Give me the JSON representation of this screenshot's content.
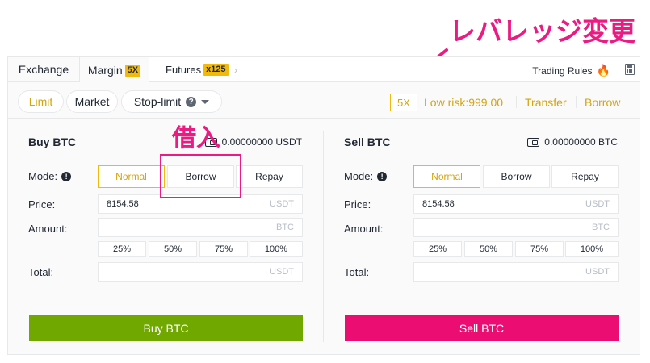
{
  "annotations": {
    "leverage_note": "レバレッジ変更",
    "borrow_note": "借入",
    "accent_color": "#ec1b83"
  },
  "tabs": {
    "exchange": "Exchange",
    "margin": "Margin",
    "margin_badge": "5X",
    "futures": "Futures",
    "futures_badge": "x125",
    "chevron": "›",
    "trading_rules": "Trading Rules"
  },
  "order_types": {
    "limit": "Limit",
    "market": "Market",
    "stop_limit": "Stop-limit",
    "help": "?"
  },
  "account_bar": {
    "leverage": "5X",
    "risk": "Low risk:999.00",
    "transfer": "Transfer",
    "borrow": "Borrow"
  },
  "buy": {
    "title": "Buy BTC",
    "balance": "0.00000000 USDT",
    "mode_label": "Mode:",
    "modes": [
      "Normal",
      "Borrow",
      "Repay"
    ],
    "price_label": "Price:",
    "price_value": "8154.58",
    "price_unit": "USDT",
    "amount_label": "Amount:",
    "amount_unit": "BTC",
    "percents": [
      "25%",
      "50%",
      "75%",
      "100%"
    ],
    "total_label": "Total:",
    "total_unit": "USDT",
    "action": "Buy BTC"
  },
  "sell": {
    "title": "Sell BTC",
    "balance": "0.00000000 BTC",
    "mode_label": "Mode:",
    "modes": [
      "Normal",
      "Borrow",
      "Repay"
    ],
    "price_label": "Price:",
    "price_value": "8154.58",
    "price_unit": "USDT",
    "amount_label": "Amount:",
    "amount_unit": "BTC",
    "percents": [
      "25%",
      "50%",
      "75%",
      "100%"
    ],
    "total_label": "Total:",
    "total_unit": "USDT",
    "action": "Sell BTC"
  },
  "colors": {
    "brand_yellow": "#f0b90b",
    "buy_green": "#70a800",
    "sell_pink": "#ec0d73"
  }
}
